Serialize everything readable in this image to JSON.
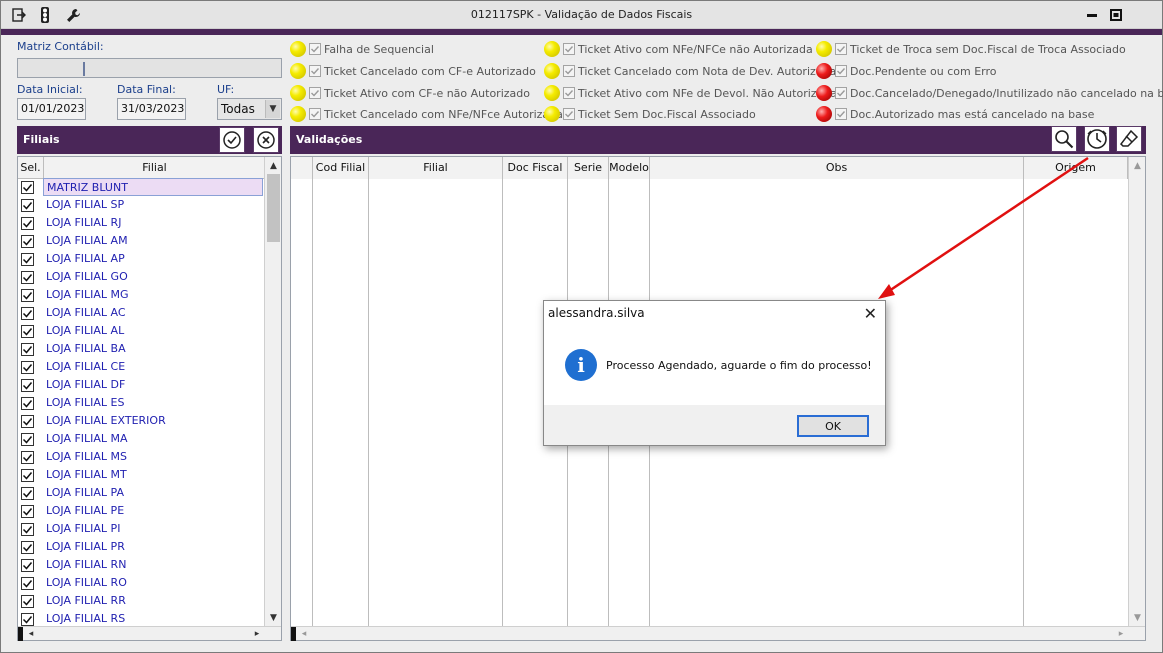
{
  "window": {
    "title": "012117SPK - Validação de Dados Fiscais"
  },
  "filters": {
    "matriz_label": "Matriz Contábil:",
    "matriz_value": "",
    "data_inicial_label": "Data Inicial:",
    "data_inicial_value": "01/01/2023",
    "data_final_label": "Data Final:",
    "data_final_value": "31/03/2023",
    "uf_label": "UF:",
    "uf_value": "Todas"
  },
  "legend": [
    {
      "label": "Falha de Sequencial",
      "color": "yellow"
    },
    {
      "label": "Ticket Cancelado com CF-e Autorizado",
      "color": "yellow"
    },
    {
      "label": "Ticket Ativo com CF-e não Autorizado",
      "color": "yellow"
    },
    {
      "label": "Ticket Cancelado com NFe/NFce Autorizada",
      "color": "yellow"
    },
    {
      "label": "Ticket Ativo com NFe/NFCe não Autorizada",
      "color": "yellow"
    },
    {
      "label": "Ticket Cancelado com Nota de Dev. Autorizada",
      "color": "yellow"
    },
    {
      "label": "Ticket Ativo com NFe de Devol. Não Autorizada",
      "color": "yellow"
    },
    {
      "label": "Ticket Sem Doc.Fiscal Associado",
      "color": "yellow"
    },
    {
      "label": "Ticket de Troca sem Doc.Fiscal de Troca Associado",
      "color": "yellow"
    },
    {
      "label": "Doc.Pendente ou com Erro",
      "color": "red"
    },
    {
      "label": "Doc.Cancelado/Denegado/Inutilizado não cancelado na base",
      "color": "red"
    },
    {
      "label": "Doc.Autorizado mas está cancelado na base",
      "color": "red"
    }
  ],
  "filiais": {
    "title": "Filiais",
    "col_sel": "Sel.",
    "col_filial": "Filial",
    "rows": [
      "MATRIZ BLUNT",
      "LOJA FILIAL SP",
      "LOJA FILIAL RJ",
      "LOJA FILIAL AM",
      "LOJA FILIAL AP",
      "LOJA FILIAL GO",
      "LOJA FILIAL MG",
      "LOJA FILIAL AC",
      "LOJA FILIAL AL",
      "LOJA FILIAL BA",
      "LOJA FILIAL CE",
      "LOJA FILIAL DF",
      "LOJA FILIAL ES",
      "LOJA FILIAL EXTERIOR",
      "LOJA FILIAL MA",
      "LOJA FILIAL MS",
      "LOJA FILIAL MT",
      "LOJA FILIAL PA",
      "LOJA FILIAL PE",
      "LOJA FILIAL PI",
      "LOJA FILIAL PR",
      "LOJA FILIAL RN",
      "LOJA FILIAL RO",
      "LOJA FILIAL RR",
      "LOJA FILIAL RS"
    ]
  },
  "validacoes": {
    "title": "Validações",
    "columns": [
      "Cod Filial",
      "Filial",
      "Doc Fiscal",
      "Serie",
      "Modelo",
      "Obs",
      "Origem"
    ]
  },
  "dialog": {
    "title": "alessandra.silva",
    "message": "Processo Agendado, aguarde o fim do processo!",
    "ok_label": "OK"
  },
  "colors": {
    "header_purple": "#4a2658",
    "link_blue": "#1f1fb0",
    "annotation_red": "#e01010"
  }
}
